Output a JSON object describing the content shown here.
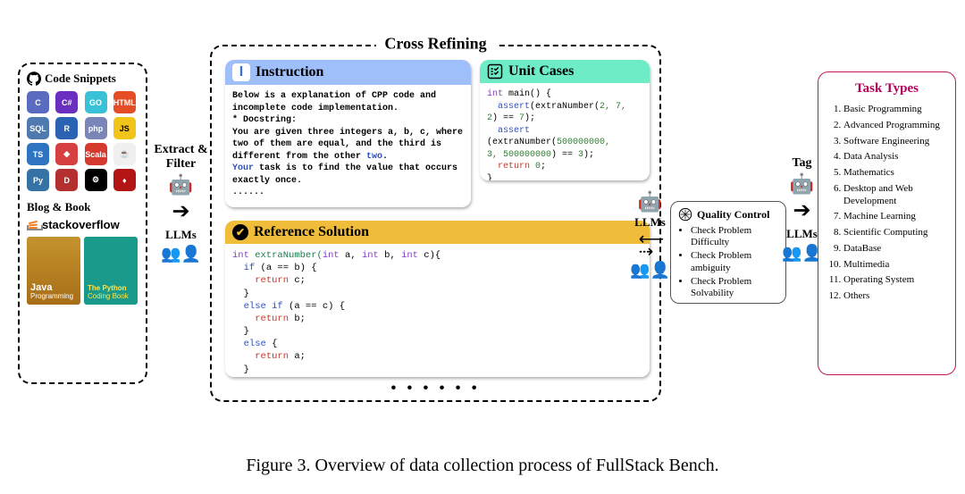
{
  "caption": "Figure 3. Overview of data collection process of FullStack Bench.",
  "sources": {
    "snippets_title": "Code Snippets",
    "blog_title": "Blog & Book",
    "stackoverflow_bold": "stack",
    "stackoverflow_rest": "overflow",
    "book1_top": "Java",
    "book1_bot": "Programming",
    "book2_top": "The Python",
    "book2_bot": "Coding Book",
    "lang_icons": [
      {
        "label": "C",
        "bg": "#5b6bbf"
      },
      {
        "label": "C#",
        "bg": "#6a2fbf"
      },
      {
        "label": "GO",
        "bg": "#39c1d7"
      },
      {
        "label": "HTML",
        "bg": "#e44d26"
      },
      {
        "label": "SQL",
        "bg": "#4f7ab0"
      },
      {
        "label": "R",
        "bg": "#2a63b3"
      },
      {
        "label": "php",
        "bg": "#7a86b8"
      },
      {
        "label": "JS",
        "bg": "#f0c419"
      },
      {
        "label": "TS",
        "bg": "#2f74c0"
      },
      {
        "label": "◆",
        "bg": "#d64040"
      },
      {
        "label": "Scala",
        "bg": "#d63a2f"
      },
      {
        "label": "☕",
        "bg": "#f0f0f0"
      },
      {
        "label": "Py",
        "bg": "#3572a5"
      },
      {
        "label": "D",
        "bg": "#b42f2f"
      },
      {
        "label": "⚙",
        "bg": "#000"
      },
      {
        "label": "♦",
        "bg": "#b31515"
      }
    ]
  },
  "pipe": {
    "extract": "Extract &",
    "filter": "Filter",
    "llms": "LLMs",
    "tag": "Tag"
  },
  "refine": {
    "title": "Cross Refining",
    "dots": "• • • • • •",
    "instruction": {
      "title": "Instruction",
      "badge": "I",
      "body_1": "Below is a explanation of CPP code and incomplete code implementation.",
      "body_2": " * Docstring:",
      "body_3": "You are given three integers a, b, c, where two of them are equal, and the third is different from the other ",
      "body_3_kw": "two",
      "body_3_end": ".",
      "body_4_kw": "Your",
      "body_4": " task is to find the value that occurs exactly once.",
      "body_5": "......"
    },
    "unit": {
      "title": "Unit Cases",
      "l1_ty": "int",
      "l1_fn": " main() {",
      "l2_kw": "assert",
      "l2_rest": "(extraNumber(",
      "l2_nums": "2, 7, 2",
      "l2_eq": ") == ",
      "l2_val": "7",
      "l2_end": ");",
      "l3_kw": "assert",
      "l3_rest": " (extraNumber(",
      "l3_nums": "500000000,",
      "l3b": "3, 500000000",
      "l3_eq": ") == ",
      "l3_val": "3",
      "l3_end": ");",
      "l4_kw": "return",
      "l4_val": " 0",
      "l4_end": ";",
      "l5": "}"
    },
    "ref": {
      "title": "Reference Solution",
      "sig_ty": "int",
      "sig_name": " extraNumber(",
      "sig_p1t": "int ",
      "sig_p1": "a, ",
      "sig_p2t": "int ",
      "sig_p2": "b, ",
      "sig_p3t": "int ",
      "sig_p3": "c){",
      "l_if": "if",
      "l_cond1": " (a == b) {",
      "l_ret": "return",
      "l_c": " c;",
      "l_cb": "}",
      "l_elif": "else if",
      "l_cond2": " (a == c) {",
      "l_b": " b;",
      "l_else": "else",
      "l_elseb": " {",
      "l_a": " a;"
    }
  },
  "qc": {
    "title": "Quality Control",
    "items": [
      "Check Problem Difficulty",
      "Check Problem ambiguity",
      "Check Problem Solvability"
    ]
  },
  "tasks": {
    "title": "Task Types",
    "items": [
      "Basic Programming",
      "Advanced Programming",
      "Software Engineering",
      "Data Analysis",
      "Mathematics",
      "Desktop and Web Development",
      "Machine Learning",
      "Scientific Computing",
      "DataBase",
      "Multimedia",
      "Operating System",
      "Others"
    ]
  }
}
